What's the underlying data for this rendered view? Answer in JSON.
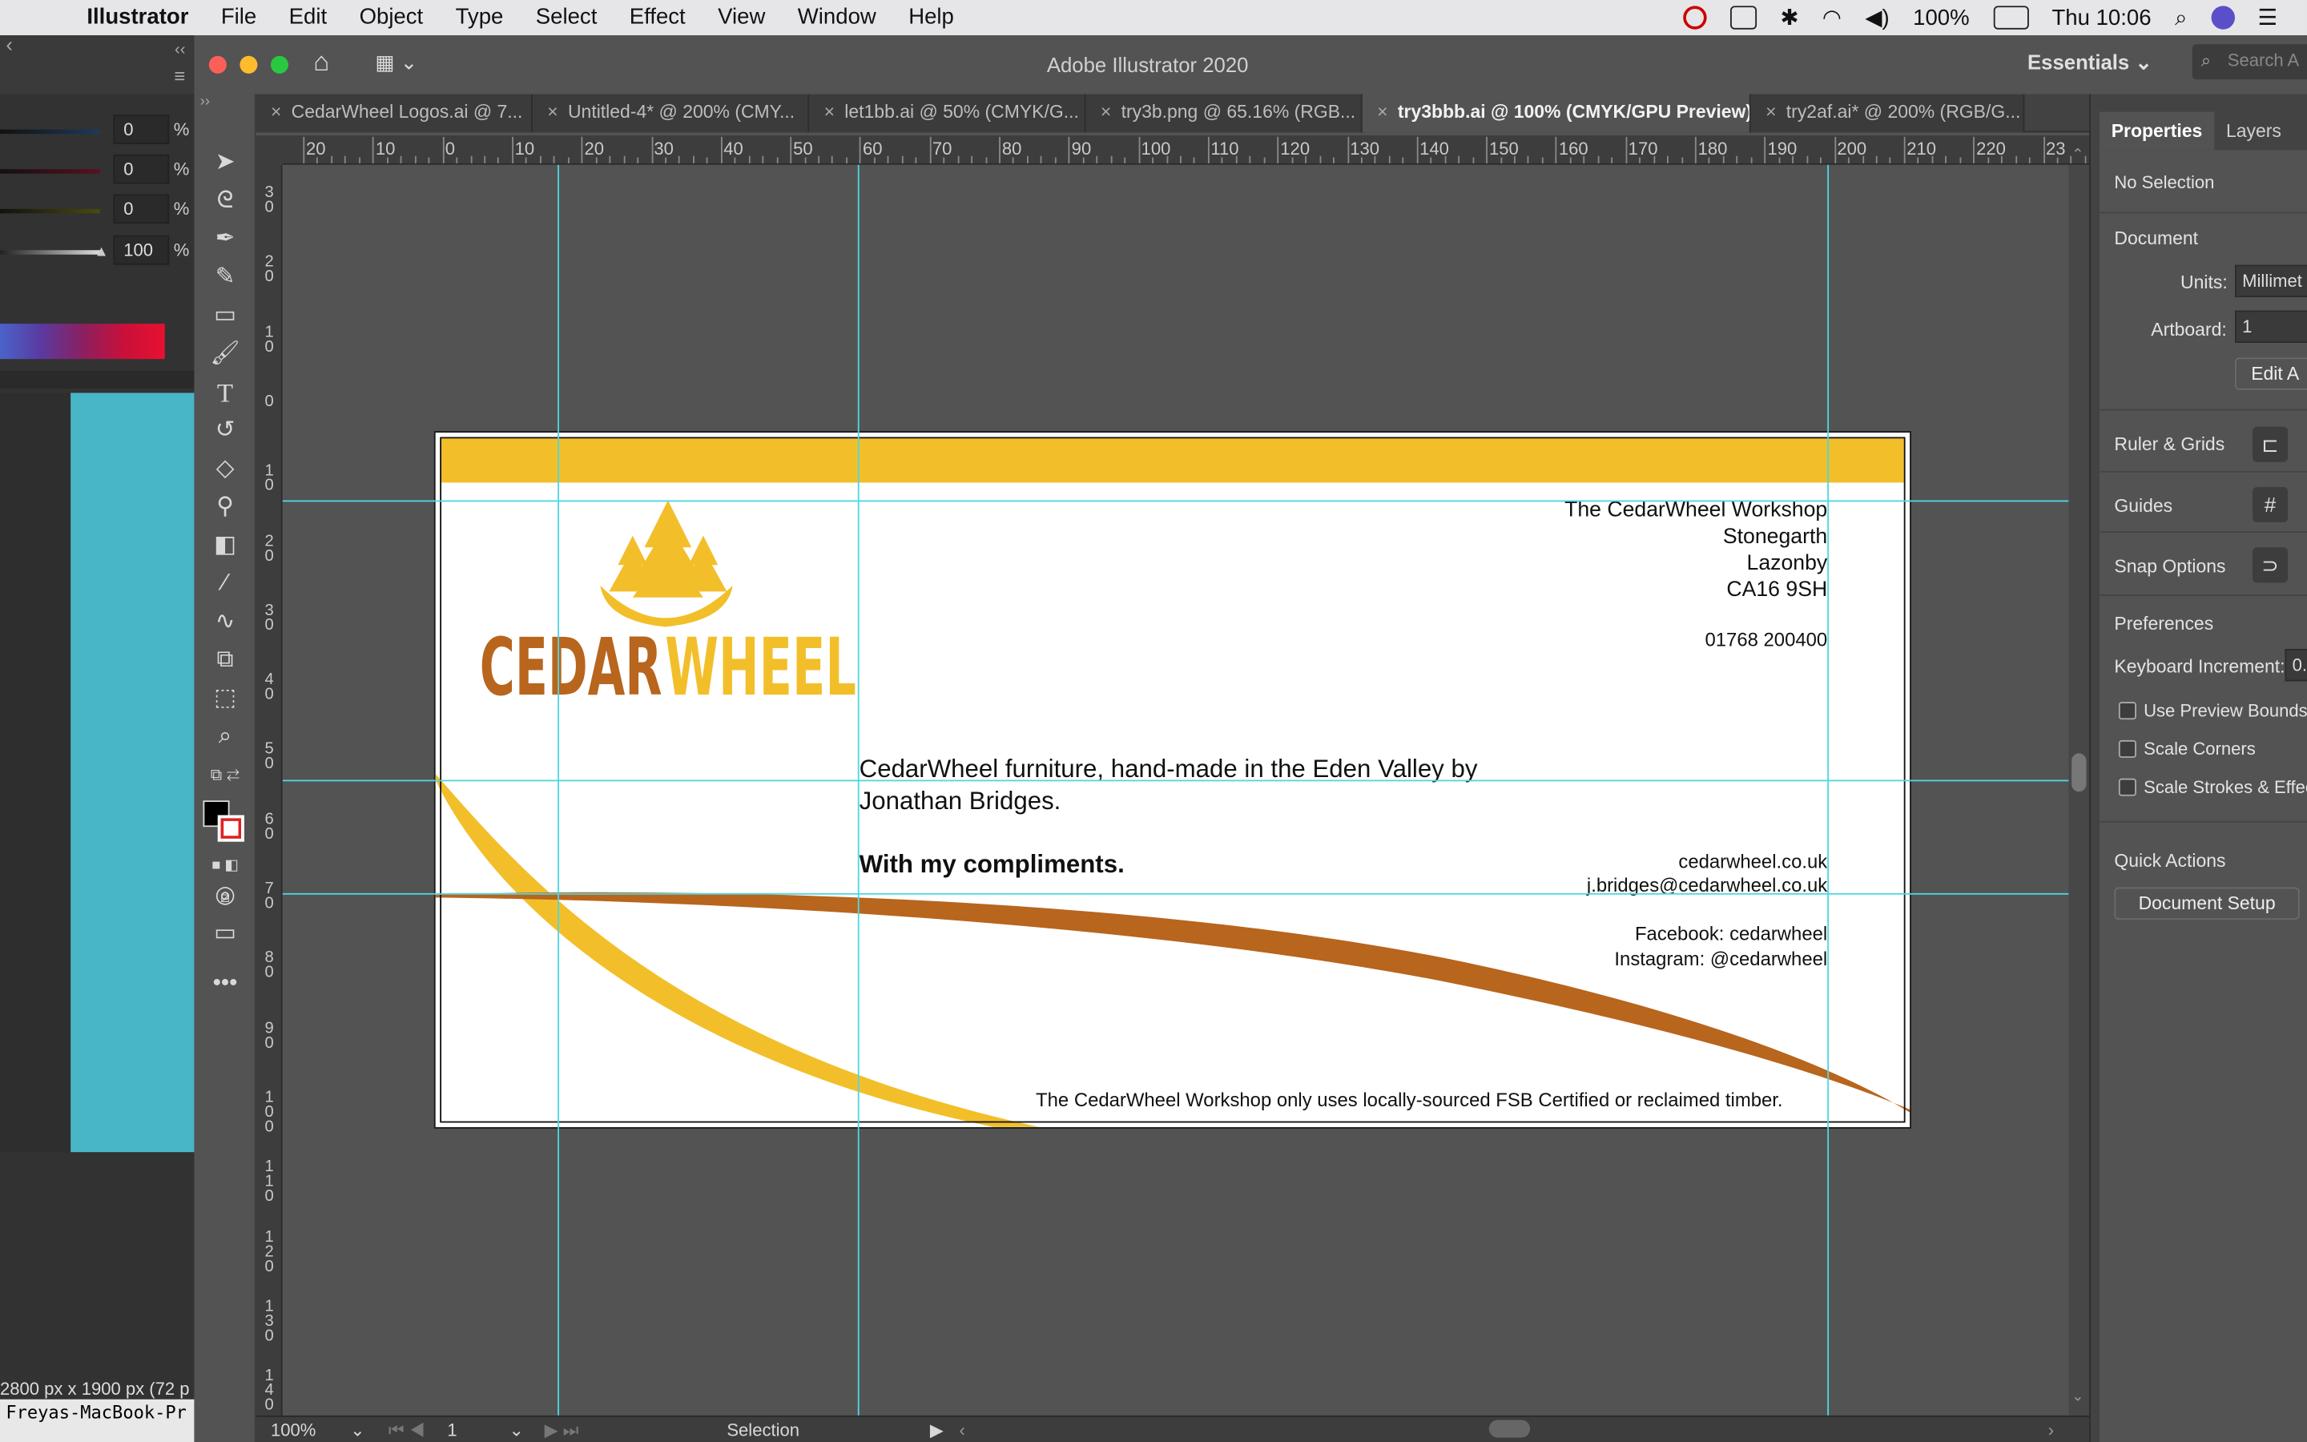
{
  "menubar": {
    "apple": "",
    "app": "Illustrator",
    "items": [
      "File",
      "Edit",
      "Object",
      "Type",
      "Select",
      "Effect",
      "View",
      "Window",
      "Help"
    ],
    "battery": "100%",
    "clock": "Thu 10:06"
  },
  "window": {
    "title": "Adobe Illustrator 2020",
    "workspace": "Essentials",
    "search_placeholder": "Search A"
  },
  "tabs": [
    {
      "label": "CedarWheel Logos.ai @ 7...",
      "active": false
    },
    {
      "label": "Untitled-4* @ 200% (CMY...",
      "active": false
    },
    {
      "label": "let1bb.ai @ 50% (CMYK/G...",
      "active": false
    },
    {
      "label": "try3b.png @ 65.16% (RGB...",
      "active": false
    },
    {
      "label": "try3bbb.ai @ 100% (CMYK/GPU Preview)",
      "active": true
    },
    {
      "label": "try2af.ai* @ 200% (RGB/G...",
      "active": false
    }
  ],
  "left_panel": {
    "values": [
      "0",
      "0",
      "0",
      "100"
    ],
    "pct": "%",
    "doc_info": "2800 px x 1900 px (72 p",
    "terminal": "Freyas-MacBook-Pr"
  },
  "hruler_labels": [
    "20",
    "10",
    "0",
    "10",
    "20",
    "30",
    "40",
    "50",
    "60",
    "70",
    "80",
    "90",
    "100",
    "110",
    "120",
    "130",
    "140",
    "150",
    "160",
    "170",
    "180",
    "190",
    "200",
    "210",
    "220",
    "23"
  ],
  "vruler_labels": [
    "30",
    "20",
    "10",
    "0",
    "10",
    "20",
    "30",
    "40",
    "50",
    "60",
    "70",
    "80",
    "90",
    "100",
    "110",
    "120",
    "130",
    "140"
  ],
  "document": {
    "logo_part1": "CEDAR",
    "logo_part2": "WHEEL",
    "address": [
      "The CedarWheel Workshop",
      "Stonegarth",
      "Lazonby",
      "CA16 9SH"
    ],
    "phone": "01768 200400",
    "blurb": "CedarWheel furniture, hand-made in the Eden Valley by Jonathan Bridges.",
    "compliments": "With my compliments.",
    "web": [
      "cedarwheel.co.uk",
      "j.bridges@cedarwheel.co.uk"
    ],
    "social": [
      "Facebook: cedarwheel",
      "Instagram: @cedarwheel"
    ],
    "footer": "The CedarWheel Workshop only uses locally-sourced FSB Certified or reclaimed timber.",
    "colors": {
      "yellow": "#f2bf2a",
      "brown": "#b8651d",
      "guide": "#4fd6e3"
    }
  },
  "properties_panel": {
    "tabs": [
      "Properties",
      "Layers"
    ],
    "selection": "No Selection",
    "document_heading": "Document",
    "units_label": "Units:",
    "units_value": "Millimet",
    "artboard_label": "Artboard:",
    "artboard_value": "1",
    "edit_artboards": "Edit A",
    "ruler_grids": "Ruler & Grids",
    "guides": "Guides",
    "snap_options": "Snap Options",
    "preferences": "Preferences",
    "keyboard_increment": "Keyboard Increment:",
    "keyboard_increment_value": "0.",
    "use_preview_bounds": "Use Preview Bounds",
    "scale_corners": "Scale Corners",
    "scale_strokes": "Scale Strokes & Effects",
    "quick_actions": "Quick Actions",
    "document_setup": "Document Setup"
  },
  "statusbar": {
    "zoom": "100%",
    "artboard_num": "1",
    "tool": "Selection"
  }
}
